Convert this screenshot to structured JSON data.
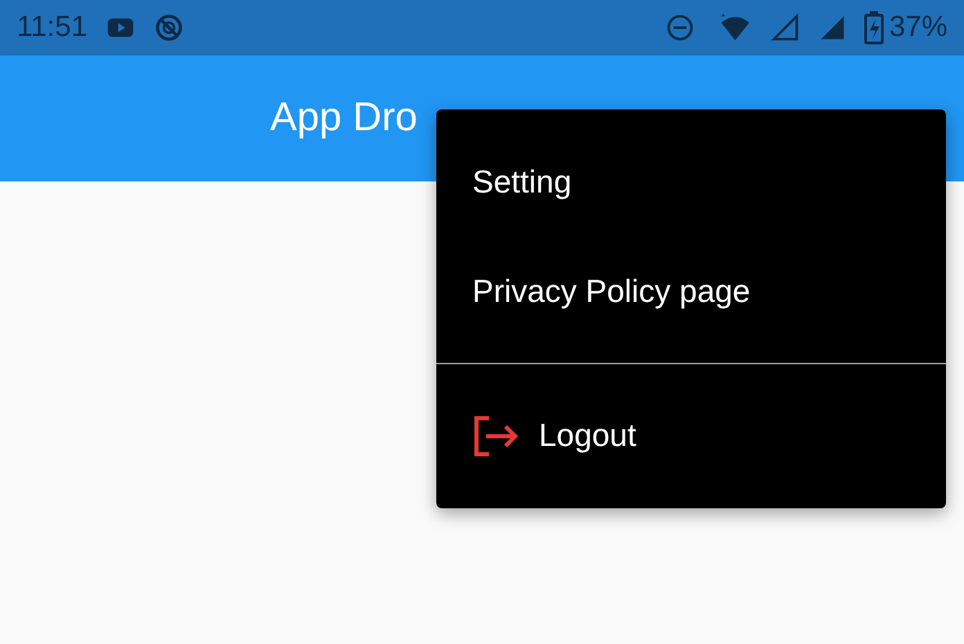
{
  "status_bar": {
    "time": "11:51",
    "battery": "37%"
  },
  "app_bar": {
    "title": "App Dro"
  },
  "menu": {
    "items": [
      {
        "kind": "text",
        "label": "Setting"
      },
      {
        "kind": "text",
        "label": "Privacy Policy page"
      },
      {
        "kind": "divider"
      },
      {
        "kind": "icon",
        "label": "Logout"
      }
    ]
  }
}
